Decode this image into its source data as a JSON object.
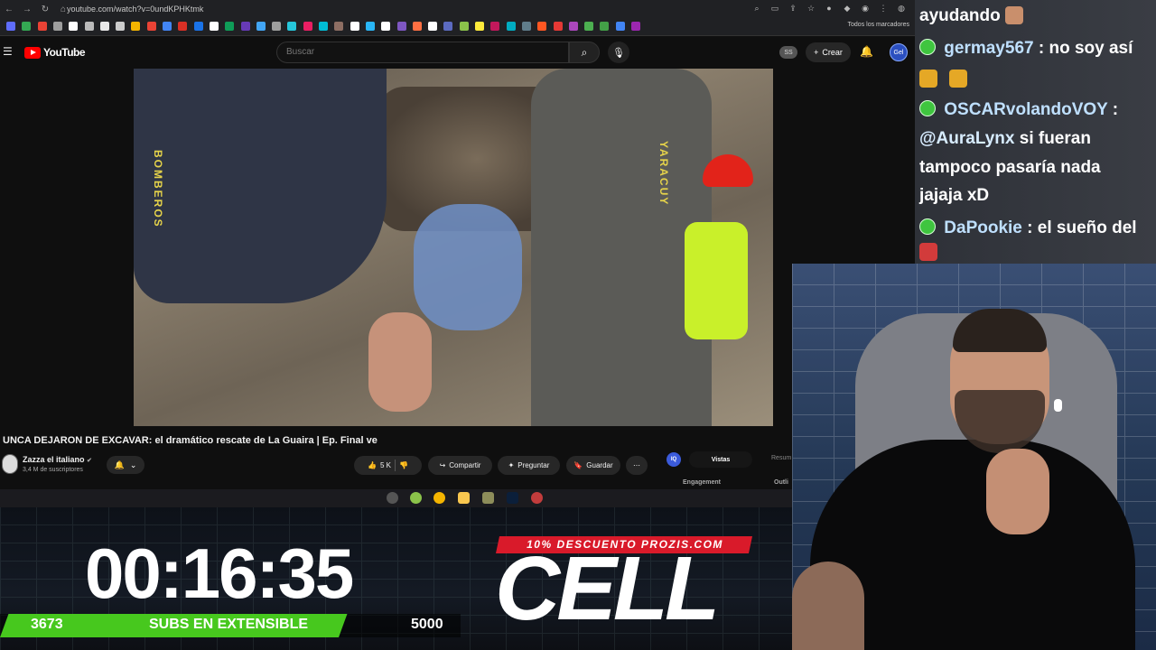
{
  "browser": {
    "url": "youtube.com/watch?v=0undKPHKtmk",
    "bookmarks_folder": "Todos los marcadores",
    "bookmark_colors": [
      "#5f6dfc",
      "#34a853",
      "#ea4335",
      "#9e9e9e",
      "#ffffff",
      "#bbbbbb",
      "#e8e8e8",
      "#cccccc",
      "#f4b400",
      "#ea4335",
      "#4285f4",
      "#d93025",
      "#1a73e8",
      "#ffffff",
      "#0f9d58",
      "#673ab7",
      "#42a5f5",
      "#9e9e9e",
      "#26c6da",
      "#e91e63",
      "#00bcd4",
      "#8d6e63",
      "#ffffff",
      "#29b6f6",
      "#ffffff",
      "#7e57c2",
      "#ff7043",
      "#ffffff",
      "#5c6bc0",
      "#8bc34a",
      "#ffeb3b",
      "#c2185b",
      "#00acc1",
      "#607d8b",
      "#ff5722",
      "#e53935",
      "#ab47bc",
      "#4caf50",
      "#43a047",
      "#4285f4",
      "#9c27b0"
    ]
  },
  "youtube": {
    "logo_text": "YouTube",
    "search_placeholder": "Buscar",
    "ss_badge": "SS",
    "create_label": "Crear",
    "avatar_text": "Gel",
    "video_title": "UNCA DEJARON DE EXCAVAR: el dramático rescate de La Guaira | Ep. Final ve",
    "video_text_left": "BOMBEROS",
    "video_text_right": "YARACUY",
    "channel_name": "Zazza el italiano",
    "channel_subs": "3,4 M de suscriptores",
    "like_count": "5 K",
    "share_label": "Compartir",
    "ask_label": "Preguntar",
    "save_label": "Guardar",
    "panel": {
      "badge": "IQ",
      "tab_active": "Vistas",
      "tab_other": "Resum",
      "label_left": "Engagement",
      "label_right": "Outli"
    }
  },
  "overlay": {
    "timer": "00:16:35",
    "subs_current": "3673",
    "subs_label": "SUBS EN EXTENSIBLE",
    "subs_goal": "5000",
    "subs_progress": 0.7346,
    "promo_text": "10% DESCUENTO PROZIS.COM",
    "promo_logo": "CELL"
  },
  "chat": {
    "messages": [
      {
        "user": "",
        "text": "ayudando"
      },
      {
        "user": "germay567",
        "text": "no soy así"
      },
      {
        "user": "OSCARvolandoVOY",
        "text": ""
      },
      {
        "mention": "@AuraLynx",
        "text": "si fueran"
      },
      {
        "text": "tampoco pasaría nada"
      },
      {
        "text": "jajaja xD"
      },
      {
        "user": "DaPookie",
        "text": "el sueño del"
      }
    ]
  },
  "colors": {
    "yt_red": "#ff0000",
    "subs_green": "#47c81e",
    "promo_red": "#d91a2a",
    "chat_badge_green": "#3fc53f"
  }
}
